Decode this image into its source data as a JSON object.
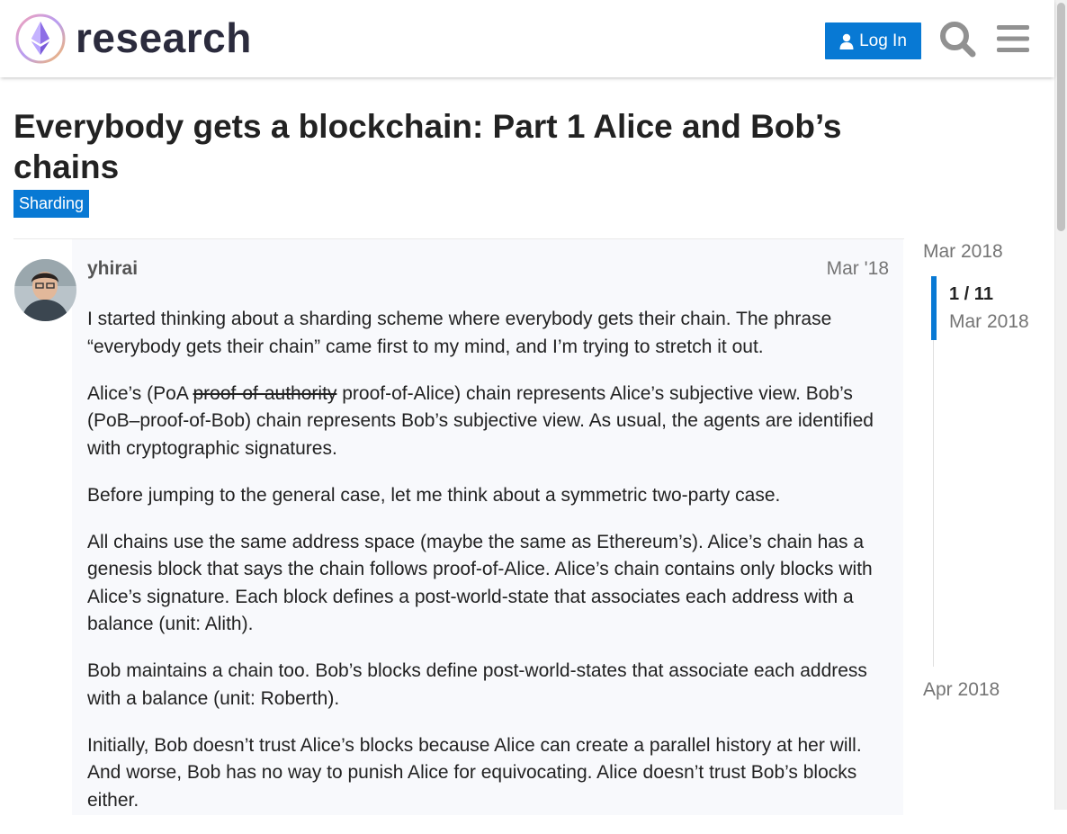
{
  "header": {
    "site_name": "research",
    "login_label": "Log In"
  },
  "topic": {
    "title": "Everybody gets a blockchain: Part 1 Alice and Bob’s chains",
    "category": "Sharding",
    "category_color": "#0879d4"
  },
  "post": {
    "author": "yhirai",
    "date": "Mar '18",
    "p1": "I started thinking about a sharding scheme where everybody gets their chain. The phrase “everybody gets their chain” came first to my mind, and I’m trying to stretch it out.",
    "p2_a": "Alice’s (PoA ",
    "p2_strike": "proof-of-authority",
    "p2_b": " proof-of-Alice) chain represents Alice’s subjective view. Bob’s (PoB–proof-of-Bob) chain represents Bob’s subjective view. As usual, the agents are identified with cryptographic signatures.",
    "p3": "Before jumping to the general case, let me think about a symmetric two-party case.",
    "p4": "All chains use the same address space (maybe the same as Ethereum’s). Alice’s chain has a genesis block that says the chain follows proof-of-Alice. Alice’s chain contains only blocks with Alice’s signature. Each block defines a post-world-state that associates each address with a balance (unit: Alith).",
    "p5": "Bob maintains a chain too. Bob’s blocks define post-world-states that associate each address with a balance (unit: Roberth).",
    "p6": "Initially, Bob doesn’t trust Alice’s blocks because Alice can create a parallel history at her will. And worse, Bob has no way to punish Alice for equivocating. Alice doesn’t trust Bob’s blocks either."
  },
  "timeline": {
    "start_date": "Mar 2018",
    "position": "1 / 11",
    "current_date": "Mar 2018",
    "end_date": "Apr 2018"
  },
  "icons": {
    "logo": "ethereum-research-logo",
    "login": "user-icon",
    "search": "search-icon",
    "menu": "hamburger-menu-icon"
  }
}
